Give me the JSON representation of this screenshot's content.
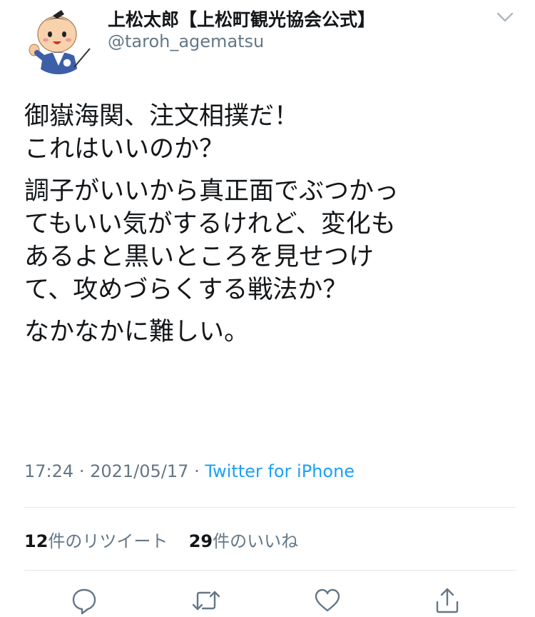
{
  "tweet": {
    "display_name": "上松太郎【上松町観光協会公式】",
    "handle": "@taroh_agematsu",
    "paragraphs": [
      "御嶽海関、注文相撲だ！\nこれはいいのか？",
      "調子がいいから真正面でぶつかっ\nてもいい気がするけれど、変化も\nあるよと黒いところを見せつけ\nて、攻めづらくする戦法か？",
      "なかなかに難しい。"
    ],
    "time": "17:24",
    "date": "2021/05/17",
    "separator": "·",
    "source": "Twitter for iPhone"
  },
  "stats": {
    "retweets_count": "12",
    "retweets_label": "件のリツイート",
    "likes_count": "29",
    "likes_label": "件のいいね"
  },
  "icons": {
    "menu": "chevron-down-icon",
    "reply": "reply-icon",
    "retweet": "retweet-icon",
    "like": "heart-icon",
    "share": "share-icon"
  },
  "colors": {
    "text": "#14171a",
    "secondary": "#657786",
    "link": "#1da1f2",
    "divider": "#e1e8ed"
  }
}
